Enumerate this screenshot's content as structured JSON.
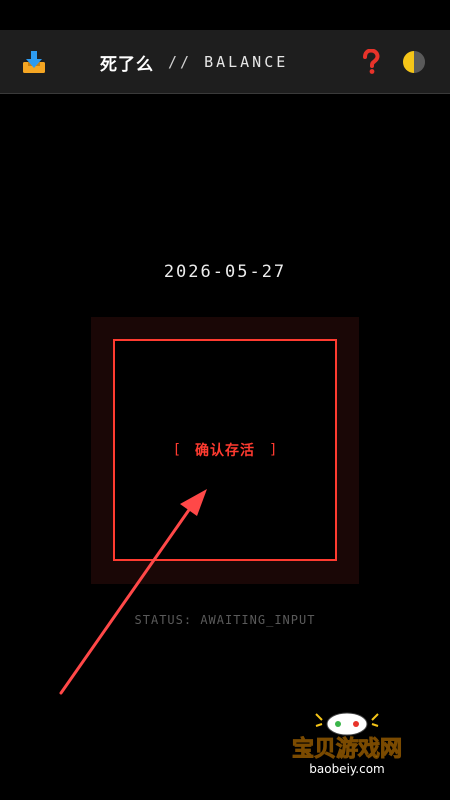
{
  "header": {
    "app_name": "死了么",
    "separator": "//",
    "mode": "BALANCE",
    "icons": {
      "download": "download-tray-icon",
      "help": "question-mark-icon",
      "theme": "half-moon-theme-icon"
    }
  },
  "main": {
    "date": "2026-05-27",
    "confirm_button": {
      "open_bracket": "[",
      "label": "确认存活",
      "close_bracket": "]"
    },
    "status": "STATUS: AWAITING_INPUT"
  },
  "watermark": {
    "title": "宝贝游戏网",
    "url": "baobeiy.com"
  },
  "colors": {
    "accent_red": "#ff3b30",
    "background": "#000000",
    "header_bg": "#1e1e1e",
    "glow": "#1a0706",
    "status_text": "#5a5a5a"
  }
}
